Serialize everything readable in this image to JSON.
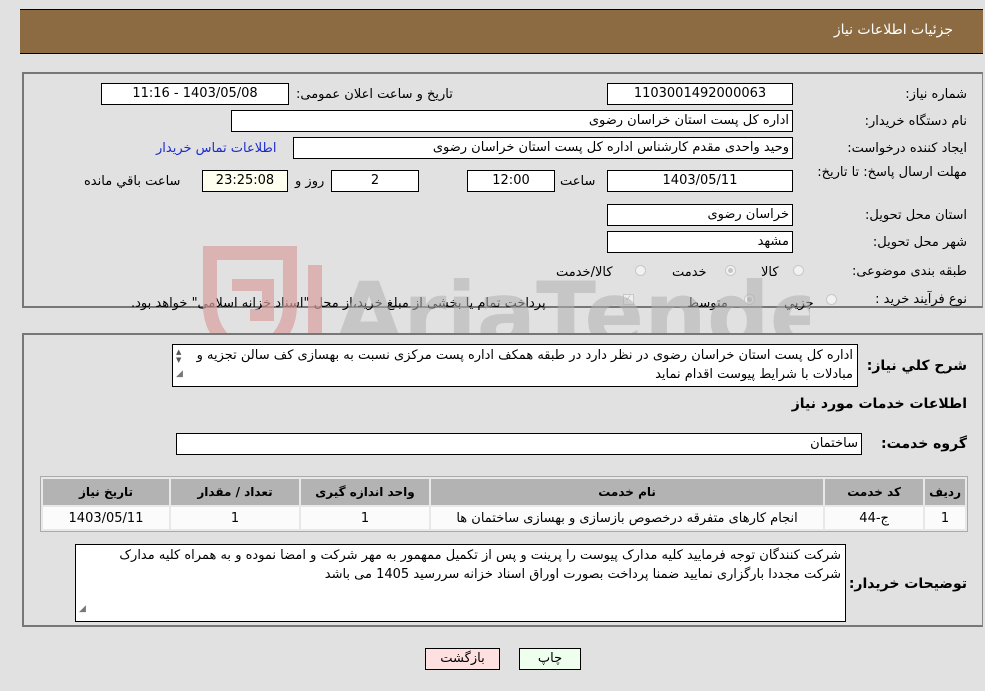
{
  "header": {
    "title": "جزئیات اطلاعات نیاز"
  },
  "form": {
    "need_number_label": "شماره نیاز:",
    "need_number": "1103001492000063",
    "announce_label": "تاریخ و ساعت اعلان عمومی:",
    "announce_value": "1403/05/08 - 11:16",
    "buyer_org_label": "نام دستگاه خریدار:",
    "buyer_org": "اداره کل پست استان خراسان رضوی",
    "requester_label": "ایجاد کننده درخواست:",
    "requester": "وحید واحدی مقدم کارشناس اداره کل پست استان خراسان رضوی",
    "contact_link": "اطلاعات تماس خریدار",
    "deadline_label": "مهلت ارسال پاسخ: تا تاریخ:",
    "deadline_date": "1403/05/11",
    "time_label": "ساعت",
    "deadline_time": "12:00",
    "days_value": "2",
    "days_label": "روز و",
    "remaining_time": "23:25:08",
    "remaining_label": "ساعت باقي مانده",
    "province_label": "استان محل تحویل:",
    "province": "خراسان رضوی",
    "city_label": "شهر محل تحویل:",
    "city": "مشهد",
    "category_label": "طبقه بندی موضوعی:",
    "category_options": [
      {
        "label": "کالا",
        "selected": false
      },
      {
        "label": "خدمت",
        "selected": true
      },
      {
        "label": "کالا/خدمت",
        "selected": false
      }
    ],
    "process_label": "نوع فرآیند خرید :",
    "process_options": [
      {
        "label": "جزيي",
        "selected": false
      },
      {
        "label": "متوسط",
        "selected": true
      }
    ],
    "treasury_checkbox_label": "پرداخت تمام یا بخشی از مبلغ خرید،از محل \"اسناد خزانه اسلامی\" خواهد بود.",
    "treasury_checked": true
  },
  "description": {
    "label": "شرح کلي نياز:",
    "text": "اداره کل پست استان خراسان رضوی در نظر دارد در طبقه همکف اداره پست مرکزی نسبت به بهسازی کف سالن تجزیه و مبادلات با شرایط پیوست اقدام نماید"
  },
  "services": {
    "section_title": "اطلاعات خدمات مورد نیاز",
    "group_label": "گروه خدمت:",
    "group_value": "ساختمان",
    "table": {
      "headers": [
        "ردیف",
        "کد خدمت",
        "نام خدمت",
        "واحد اندازه گیری",
        "تعداد / مقدار",
        "تاریخ نیاز"
      ],
      "rows": [
        [
          "1",
          "ج-44",
          "انجام کارهای متفرقه درخصوص بازسازی و بهسازی ساختمان ها",
          "1",
          "1",
          "1403/05/11"
        ]
      ]
    }
  },
  "buyer_notes": {
    "label": "توضیحات خریدار:",
    "text": "شرکت کنندگان توجه فرمایید کلیه مدارک پیوست را پرینت و پس از تکمیل ممهمور به مهر شرکت و امضا نموده و به همراه کلیه مدارک شرکت مجددا بارگزاری نمایید ضمنا پرداخت بصورت اوراق اسناد خزانه سررسید 1405 می باشد"
  },
  "buttons": {
    "print": "چاپ",
    "back": "بازگشت"
  },
  "watermark": {
    "text": "AriaTender.neT"
  },
  "colors": {
    "header_bg": "#8c6b42",
    "link": "#1d2cc9",
    "back_btn": "#ffe0e0",
    "print_btn": "#eeffee",
    "remaining_bg": "#fffff0"
  }
}
